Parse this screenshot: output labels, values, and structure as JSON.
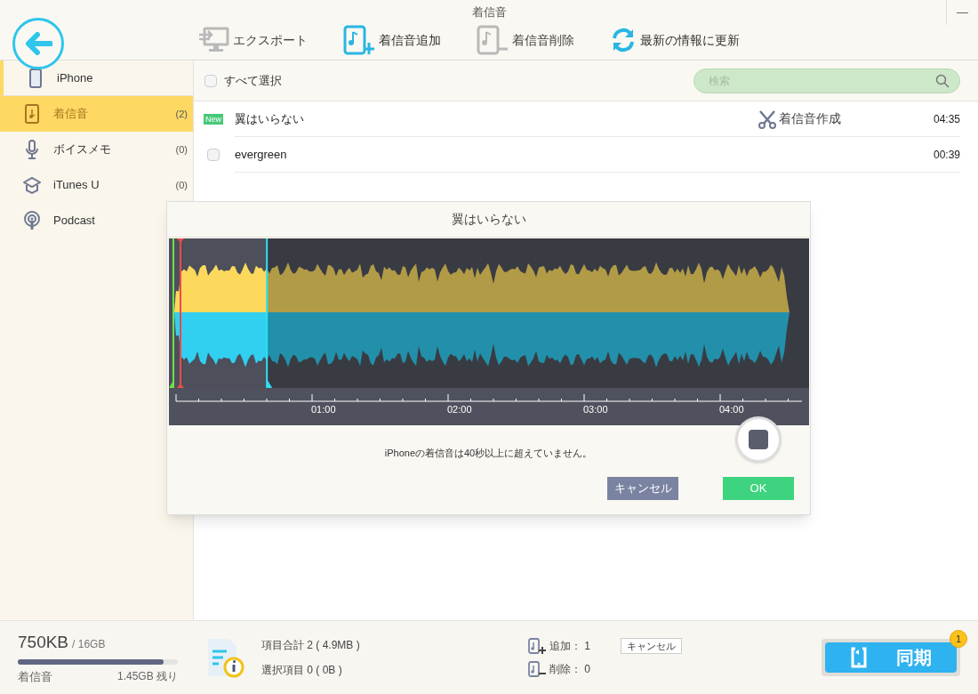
{
  "window": {
    "title": "着信音",
    "minimize": "—"
  },
  "toolbar": [
    {
      "kind": "export",
      "label": "エクスポート",
      "disabled": true
    },
    {
      "kind": "add",
      "label": "着信音追加",
      "disabled": false
    },
    {
      "kind": "delete",
      "label": "着信音削除",
      "disabled": true
    },
    {
      "kind": "refresh",
      "label": "最新の情報に更新",
      "disabled": false
    }
  ],
  "sidebar": {
    "items": [
      {
        "kind": "phone",
        "label": "iPhone",
        "selected": false
      },
      {
        "kind": "ringtone",
        "label": "着信音",
        "count": "(2)",
        "selected": true
      },
      {
        "kind": "voice",
        "label": "ボイスメモ",
        "count": "(0)",
        "selected": false
      },
      {
        "kind": "itunesu",
        "label": "iTunes U",
        "count": "(0)",
        "selected": false
      },
      {
        "kind": "podcast",
        "label": "Podcast",
        "selected": false
      }
    ]
  },
  "list_header": {
    "select_all": {
      "label": "すべて選択",
      "checked": false
    },
    "search": {
      "placeholder": "検索"
    }
  },
  "rows": [
    {
      "title": "翼はいらない",
      "badge": "New",
      "action": "着信音作成",
      "duration": "04:35"
    },
    {
      "title": "evergreen",
      "duration": "00:39",
      "checked": false
    }
  ],
  "dialog": {
    "title": "翼はいらない",
    "selection": {
      "level": 0.153
    },
    "time_labels": [
      "01:00",
      "02:00",
      "03:00",
      "04:00"
    ],
    "message": "iPhoneの着信音は40秒以上に超えていません。",
    "buttons": [
      {
        "kind": "cancel",
        "label": "キャンセル"
      },
      {
        "kind": "ok",
        "label": "OK"
      }
    ]
  },
  "footer": {
    "used": "750KB",
    "total": "/ 16GB",
    "level": 0.91,
    "category": "着信音",
    "remaining": "1.45GB 残り",
    "info": [
      "項目合計 2 ( 4.9MB )",
      "選択項目 0 ( 0B )"
    ],
    "changes": [
      {
        "kind": "add",
        "label": "追加： 1",
        "button": "キャンセル"
      },
      {
        "kind": "delete",
        "label": "削除： 0"
      }
    ],
    "sync": {
      "label": "同期",
      "badge": "1"
    }
  }
}
